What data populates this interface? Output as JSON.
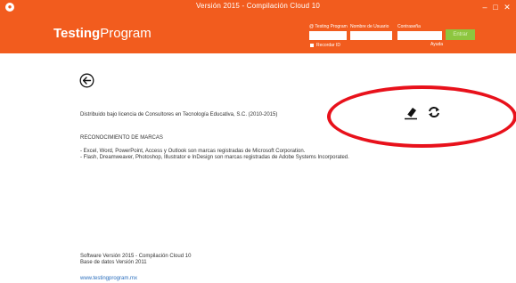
{
  "window": {
    "title": "Versión 2015 - Compilación Cloud 10",
    "minimize": "–",
    "maximize": "□",
    "close": "✕"
  },
  "header": {
    "brand_bold": "Testing",
    "brand_light": "Program",
    "login": {
      "field1_label": "@ Testing Program",
      "user_label": "Nombre de Usuario",
      "password_label": "Contraseña",
      "remember_label": "Recordar ID",
      "help_label": "Ayuda",
      "login_button": "Entrar"
    }
  },
  "main": {
    "license": "Distribuido bajo licencia de Consultores en Tecnología Educativa, S.C. (2010-2015)",
    "trademarks_title": "RECONOCIMIENTO DE MARCAS",
    "trademark_lines": [
      "- Excel, Word, PowerPoint, Access y Outlook son marcas registradas de Microsoft Corporation.",
      "- Flash, Dreamweaver, Photoshop, Illustrator e InDesign son marcas registradas de Adobe Systems Incorporated."
    ]
  },
  "footer": {
    "software_version": "Software Versión 2015 - Compilación Cloud 10",
    "db_version": "Base de datos Versión 2011",
    "website": "www.testingprogram.mx"
  },
  "icons": {
    "back": "arrow-left-circle-icon",
    "eraser": "eraser-icon",
    "refresh": "refresh-icon"
  },
  "colors": {
    "brand_orange": "#f25c1e",
    "login_green": "#8dc63f",
    "annotation_red": "#e8111b"
  }
}
